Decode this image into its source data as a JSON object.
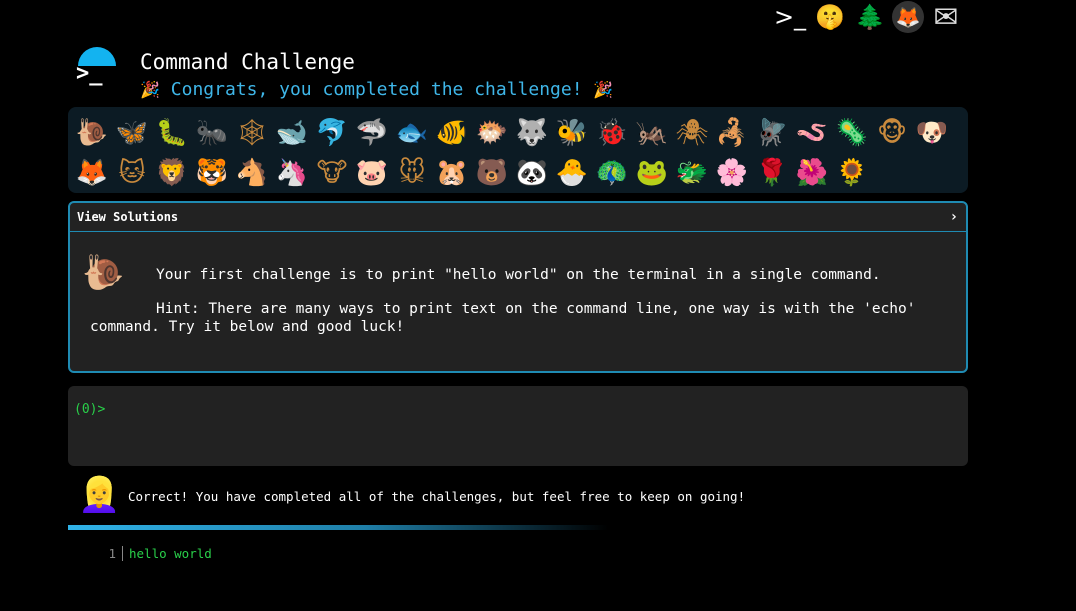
{
  "top_icons": [
    {
      "name": "terminal-icon",
      "glyph": ">_"
    },
    {
      "name": "shushing-face-icon",
      "glyph": "🤫"
    },
    {
      "name": "tree-icon",
      "glyph": "🌲"
    },
    {
      "name": "gitlab-icon",
      "glyph": "🦊"
    },
    {
      "name": "mail-icon",
      "glyph": "✉"
    }
  ],
  "header": {
    "title": "Command Challenge",
    "subtitle_party_left": "🎉",
    "subtitle": "Congrats, you completed the challenge!",
    "subtitle_party_right": "🎉"
  },
  "animals": [
    {
      "name": "snail-icon",
      "glyph": "🐌"
    },
    {
      "name": "butterfly-icon",
      "glyph": "🦋"
    },
    {
      "name": "caterpillar-icon",
      "glyph": "🐛"
    },
    {
      "name": "ant-icon",
      "glyph": "🐜"
    },
    {
      "name": "spider-web-icon",
      "glyph": "🕸"
    },
    {
      "name": "whale-icon",
      "glyph": "🐋"
    },
    {
      "name": "dolphin-icon",
      "glyph": "🐬"
    },
    {
      "name": "shark-icon",
      "glyph": "🦈"
    },
    {
      "name": "fish-icon",
      "glyph": "🐟"
    },
    {
      "name": "tropical-fish-icon",
      "glyph": "🐠"
    },
    {
      "name": "blowfish-icon",
      "glyph": "🐡"
    },
    {
      "name": "wolf-icon",
      "glyph": "🐺"
    },
    {
      "name": "bee-icon",
      "glyph": "🐝"
    },
    {
      "name": "ladybug-icon",
      "glyph": "🐞"
    },
    {
      "name": "cricket-icon",
      "glyph": "🦗"
    },
    {
      "name": "spider-icon",
      "glyph": "🕷"
    },
    {
      "name": "scorpion-icon",
      "glyph": "🦂"
    },
    {
      "name": "fly-icon",
      "glyph": "🪰"
    },
    {
      "name": "worm-icon",
      "glyph": "🪱"
    },
    {
      "name": "microbe-icon",
      "glyph": "🦠"
    },
    {
      "name": "monkey-icon",
      "glyph": "🐵"
    },
    {
      "name": "dog-icon",
      "glyph": "🐶"
    },
    {
      "name": "fox-icon",
      "glyph": "🦊"
    },
    {
      "name": "cat-icon",
      "glyph": "🐱"
    },
    {
      "name": "lion-icon",
      "glyph": "🦁"
    },
    {
      "name": "tiger-icon",
      "glyph": "🐯"
    },
    {
      "name": "horse-icon",
      "glyph": "🐴"
    },
    {
      "name": "unicorn-icon",
      "glyph": "🦄"
    },
    {
      "name": "cow-icon",
      "glyph": "🐮"
    },
    {
      "name": "pig-icon",
      "glyph": "🐷"
    },
    {
      "name": "mouse-icon",
      "glyph": "🐭"
    },
    {
      "name": "hamster-icon",
      "glyph": "🐹"
    },
    {
      "name": "bear-icon",
      "glyph": "🐻"
    },
    {
      "name": "panda-icon",
      "glyph": "🐼"
    },
    {
      "name": "hatching-chick-icon",
      "glyph": "🐣"
    },
    {
      "name": "peacock-icon",
      "glyph": "🦚"
    },
    {
      "name": "frog-icon",
      "glyph": "🐸"
    },
    {
      "name": "dragon-icon",
      "glyph": "🐲"
    },
    {
      "name": "cherry-blossom-icon",
      "glyph": "🌸"
    },
    {
      "name": "rose-icon",
      "glyph": "🌹"
    },
    {
      "name": "hibiscus-icon",
      "glyph": "🌺"
    },
    {
      "name": "sunflower-icon",
      "glyph": "🌻"
    }
  ],
  "solutions_panel": {
    "header": "View Solutions",
    "chevron": "›",
    "avatar_glyph": "🐌",
    "challenge": "Your first challenge is to print \"hello world\" on the terminal in a single command.",
    "hint": "Hint: There are many ways to print text on the command line, one way is with the 'echo' command. Try it below and good luck!"
  },
  "terminal": {
    "prompt": "(0)>"
  },
  "feedback": {
    "avatar_glyph": "👱‍♀️",
    "message": "Correct! You have completed all of the challenges, but feel free to keep on going!"
  },
  "output": {
    "line_number": "1",
    "text": "hello world"
  }
}
